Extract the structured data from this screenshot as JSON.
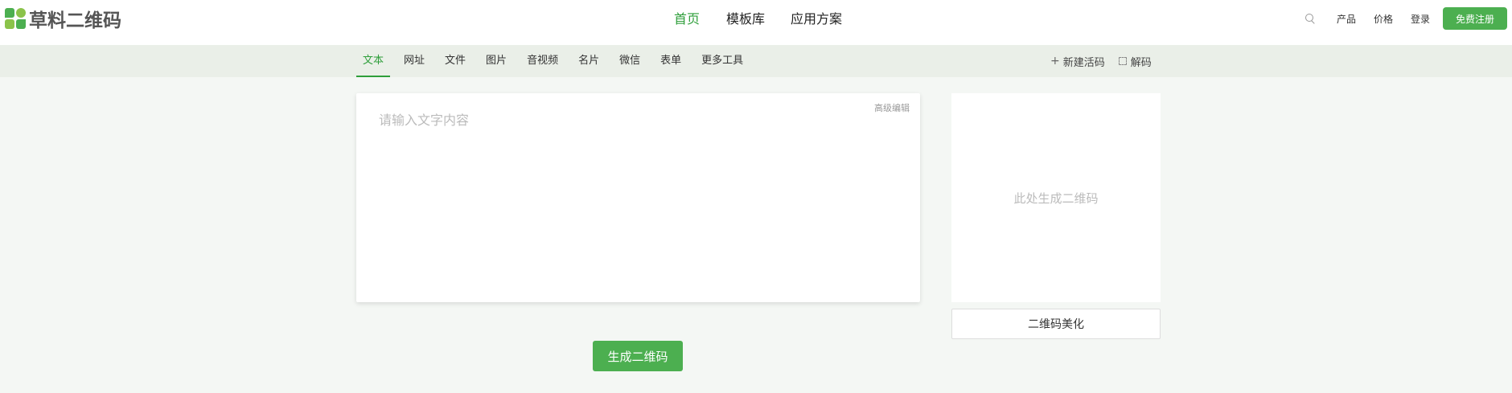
{
  "brand": {
    "name": "草料二维码"
  },
  "main_nav": [
    {
      "label": "首页",
      "active": true
    },
    {
      "label": "模板库",
      "active": false
    },
    {
      "label": "应用方案",
      "active": false
    }
  ],
  "right_nav": {
    "products": "产品",
    "pricing": "价格",
    "login": "登录",
    "signup": "免费注册"
  },
  "subnav": {
    "tabs": [
      {
        "label": "文本",
        "active": true
      },
      {
        "label": "网址"
      },
      {
        "label": "文件"
      },
      {
        "label": "图片"
      },
      {
        "label": "音视频"
      },
      {
        "label": "名片"
      },
      {
        "label": "微信"
      },
      {
        "label": "表单"
      },
      {
        "label": "更多工具"
      }
    ],
    "new_live_code": "新建活码",
    "decode": "解码"
  },
  "editor": {
    "placeholder": "请输入文字内容",
    "value": "",
    "advanced_edit": "高级编辑"
  },
  "generate_button": "生成二维码",
  "qr_panel": {
    "placeholder": "此处生成二维码",
    "beautify_button": "二维码美化"
  },
  "colors": {
    "accent": "#4caf50",
    "active_text": "#2e9e3a",
    "subnav_bg": "#eaefe8",
    "page_bg": "#f4f7f4"
  }
}
